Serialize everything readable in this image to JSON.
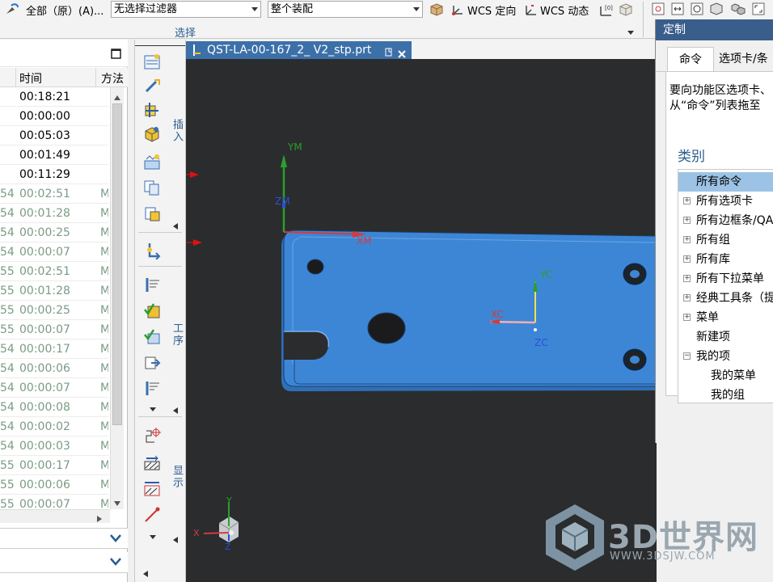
{
  "toolbar": {
    "filter_scope_label": "全部（原）(A)...",
    "filter_select": "无选择过滤器",
    "assembly_select": "整个装配",
    "wcs_orient": "WCS 定向",
    "wcs_dynamic": "WCS 动态",
    "group_label": "选择"
  },
  "navigator": {
    "col_time": "时间",
    "col_method": "方法",
    "rows": [
      {
        "c1": "",
        "time": "00:18:21",
        "method": "",
        "faded": false
      },
      {
        "c1": "",
        "time": "00:00:00",
        "method": "",
        "faded": false
      },
      {
        "c1": "",
        "time": "00:05:03",
        "method": "",
        "faded": false
      },
      {
        "c1": "",
        "time": "00:01:49",
        "method": "",
        "faded": false
      },
      {
        "c1": "",
        "time": "00:11:29",
        "method": "",
        "faded": false
      },
      {
        "c1": "54",
        "time": "00:02:51",
        "method": "M",
        "faded": true
      },
      {
        "c1": "54",
        "time": "00:01:28",
        "method": "M",
        "faded": true
      },
      {
        "c1": "54",
        "time": "00:00:25",
        "method": "M",
        "faded": true
      },
      {
        "c1": "54",
        "time": "00:00:07",
        "method": "M",
        "faded": true
      },
      {
        "c1": "55",
        "time": "00:02:51",
        "method": "M",
        "faded": true
      },
      {
        "c1": "55",
        "time": "00:01:28",
        "method": "M",
        "faded": true
      },
      {
        "c1": "55",
        "time": "00:00:25",
        "method": "M",
        "faded": true
      },
      {
        "c1": "55",
        "time": "00:00:07",
        "method": "M",
        "faded": true
      },
      {
        "c1": "54",
        "time": "00:00:17",
        "method": "M",
        "faded": true
      },
      {
        "c1": "54",
        "time": "00:00:06",
        "method": "M",
        "faded": true
      },
      {
        "c1": "54",
        "time": "00:00:07",
        "method": "M",
        "faded": true
      },
      {
        "c1": "54",
        "time": "00:00:08",
        "method": "M",
        "faded": true
      },
      {
        "c1": "54",
        "time": "00:00:02",
        "method": "M",
        "faded": true
      },
      {
        "c1": "54",
        "time": "00:00:03",
        "method": "M",
        "faded": true
      },
      {
        "c1": "55",
        "time": "00:00:17",
        "method": "M",
        "faded": true
      },
      {
        "c1": "55",
        "time": "00:00:06",
        "method": "M",
        "faded": true
      },
      {
        "c1": "55",
        "time": "00:00:07",
        "method": "M",
        "faded": true
      }
    ]
  },
  "ribbon": {
    "insert_label": "插入",
    "operation_label": "工序",
    "display_label": "显示"
  },
  "document": {
    "tab_title": "QST-LA-00-167_2_ V2_stp.prt"
  },
  "viewport": {
    "axes": {
      "ym": "YM",
      "zm": "ZM",
      "xm": "XM",
      "yc": "YC",
      "xc": "XC",
      "zc": "ZC",
      "tx": "X",
      "ty": "Y",
      "tz": "Z"
    }
  },
  "customize": {
    "title": "定制",
    "tab_commands": "命令",
    "tab_tabs": "选项卡/条",
    "hint_line1": "要向功能区选项卡、",
    "hint_line2": "从“命令”列表拖至",
    "category_label": "类别",
    "items": [
      {
        "label": "所有命令",
        "expandable": false,
        "selected": true,
        "indent": 0
      },
      {
        "label": "所有选项卡",
        "expandable": true,
        "selected": false,
        "indent": 0
      },
      {
        "label": "所有边框条/QA",
        "expandable": true,
        "selected": false,
        "indent": 0
      },
      {
        "label": "所有组",
        "expandable": true,
        "selected": false,
        "indent": 0
      },
      {
        "label": "所有库",
        "expandable": true,
        "selected": false,
        "indent": 0
      },
      {
        "label": "所有下拉菜单",
        "expandable": true,
        "selected": false,
        "indent": 0
      },
      {
        "label": "经典工具条（提",
        "expandable": true,
        "selected": false,
        "indent": 0
      },
      {
        "label": "菜单",
        "expandable": true,
        "selected": false,
        "indent": 0
      },
      {
        "label": "新建项",
        "expandable": false,
        "selected": false,
        "indent": 0
      },
      {
        "label": "我的项",
        "expandable": "minus",
        "selected": false,
        "indent": 0
      },
      {
        "label": "我的菜单",
        "expandable": false,
        "selected": false,
        "indent": 1
      },
      {
        "label": "我的组",
        "expandable": false,
        "selected": false,
        "indent": 1
      }
    ]
  },
  "watermark": {
    "brand": "3D世界网",
    "url": "WWW.3DSJW.COM"
  },
  "colors": {
    "part_blue": "#3d86d6",
    "viewport_bg": "#2b2c2e",
    "tab_blue": "#3c70a9",
    "dialog_title": "#3a5e8c"
  }
}
